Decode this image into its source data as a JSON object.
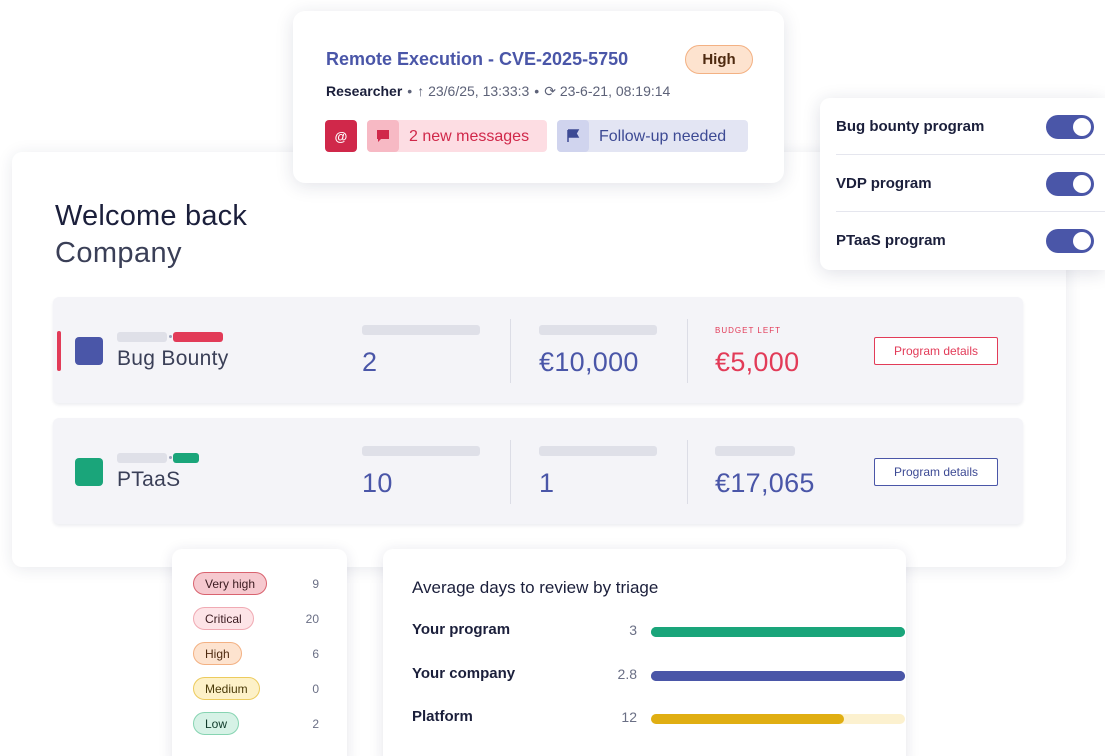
{
  "notification": {
    "title": "Remote Execution - CVE-2025-5750",
    "severity": "High",
    "researcher": "Researcher",
    "separator": "•",
    "submitted": "23/6/25, 13:33:3",
    "updated": "23-6-21, 08:19:14",
    "mention_symbol": "@",
    "messages_tag": "2 new messages",
    "follow_tag": "Follow-up needed",
    "colors": {
      "title": "#4a56a8",
      "messages": "#d0284a",
      "follow": "#3d4a94"
    }
  },
  "settings": {
    "items": [
      {
        "label": "Bug bounty program",
        "enabled": true
      },
      {
        "label": "VDP program",
        "enabled": true
      },
      {
        "label": "PTaaS program",
        "enabled": true
      }
    ]
  },
  "welcome": {
    "title": "Welcome back",
    "subtitle": "Company"
  },
  "programs": [
    {
      "name": "Bug Bounty",
      "color": "#4a56a8",
      "tag_color": "#e23b58",
      "col1_value": "2",
      "col2_value": "€10,000",
      "col3_label": "BUDGET LEFT",
      "col3_value": "€5,000",
      "col3_color": "#e23b58",
      "button_label": "Program details"
    },
    {
      "name": "PTaaS",
      "color": "#1aa57a",
      "tag_color": "#1aa57a",
      "col1_value": "10",
      "col2_value": "1",
      "col3_label": "",
      "col3_value": "€17,065",
      "col3_color": "#4a56a8",
      "button_label": "Program details"
    }
  ],
  "severity_counts": [
    {
      "label": "Very high",
      "count": "9",
      "bg": "#f6c9cf",
      "border": "#d9636f",
      "text": "#3a1a1f"
    },
    {
      "label": "Critical",
      "count": "20",
      "bg": "#fde4e7",
      "border": "#f0aab3",
      "text": "#3a1a1f"
    },
    {
      "label": "High",
      "count": "6",
      "bg": "#fde3cf",
      "border": "#f3b183",
      "text": "#4e2a10"
    },
    {
      "label": "Medium",
      "count": "0",
      "bg": "#fdf1c8",
      "border": "#eccb5d",
      "text": "#4a3a08"
    },
    {
      "label": "Low",
      "count": "2",
      "bg": "#d6f2e6",
      "border": "#87d4b2",
      "text": "#0f3a2a"
    }
  ],
  "triage": {
    "title": "Average days to review by triage",
    "rows": [
      {
        "label": "Your program",
        "value": "3",
        "fill_fraction": 1.0,
        "color": "#1aa57a",
        "track": "#1aa57a"
      },
      {
        "label": "Your company",
        "value": "2.8",
        "fill_fraction": 1.0,
        "color": "#4a56a8",
        "track": "#4a56a8"
      },
      {
        "label": "Platform",
        "value": "12",
        "fill_fraction": 0.76,
        "color": "#e0ae12",
        "track": "#fcf1cf"
      }
    ]
  }
}
